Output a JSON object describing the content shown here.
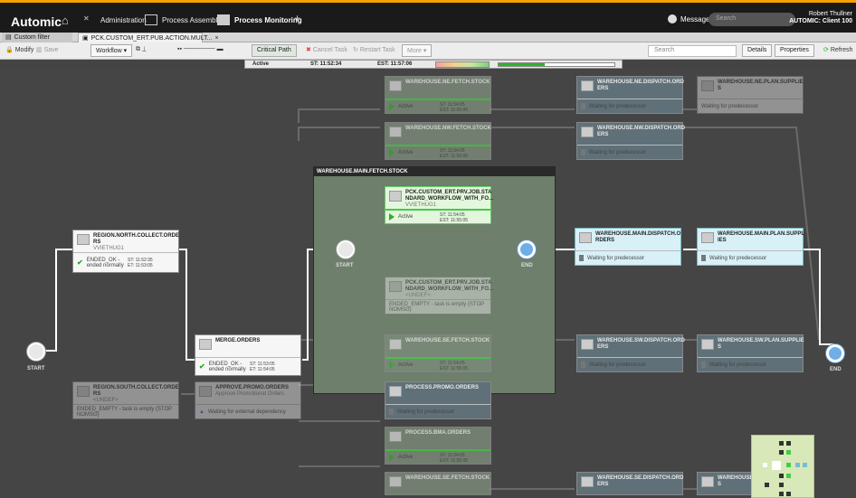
{
  "top": {
    "logo": "Automic",
    "nav": [
      "Administration",
      "Process Assembly",
      "Process Monitoring"
    ],
    "plus": "+",
    "messages": "Messages",
    "search_placeholder": "Search",
    "user_name": "Robert Thullner",
    "user_client": "AUTOMIC: Client 100",
    "accent": "#f5a000"
  },
  "tabs": {
    "filter": "Custom filter",
    "open": "PCK.CUSTOM_ERT.PUB.ACTION.MULT...",
    "close": "×"
  },
  "toolbar": {
    "modify": "Modify",
    "save": "Save",
    "workflow": "Workflow",
    "critical_path": "Critical Path",
    "cancel": "Cancel Task",
    "restart": "Restart Task",
    "more": "More",
    "search_placeholder": "Search",
    "details": "Details",
    "properties": "Properties",
    "refresh": "Refresh"
  },
  "status": {
    "state": "Active",
    "start": "ST: 11:52:34",
    "est": "EST: 11:57:06",
    "progress": 0.4
  },
  "group": {
    "title": "WAREHOUSE.MAIN.FETCH.STOCK"
  },
  "labels": {
    "start": "START",
    "end": "END"
  },
  "nodes": {
    "ne_fetch": {
      "title": "WAREHOUSE.NE.FETCH.STOCK",
      "status": "Active",
      "st": "ST: 11:54:05",
      "est": "EST: 11:55:05"
    },
    "ne_dispatch": {
      "title": "WAREHOUSE.NE.DISPATCH.ORD ERS",
      "status": "Waiting for predecessor"
    },
    "ne_plan": {
      "title": "WAREHOUSE.NE.PLAN.SUPPLIE S",
      "status": "Waiting for predecessor"
    },
    "nw_fetch": {
      "title": "WAREHOUSE.NW.FETCH.STOCK",
      "status": "Active",
      "st": "ST: 11:54:05",
      "est": "EST: 11:55:05"
    },
    "nw_dispatch": {
      "title": "WAREHOUSE.NW.DISPATCH.ORD ERS",
      "status": "Waiting for predecessor"
    },
    "north": {
      "title": "REGION.NORTH.COLLECT.ORDE RS",
      "sub": "VVIETHUG1",
      "status": "ENDED_OK - ended normally",
      "st": "ST: 11:52:35",
      "est": "ET: 11:53:05"
    },
    "inner_active": {
      "title": "PCK.CUSTOM_ERT.PRV.JOB.STA NDARD_WORKFLOW_WITH_FO...",
      "sub": "VVIETHUG1",
      "status": "Active",
      "st": "ST: 11:54:05",
      "est": "EST: 11:55:05"
    },
    "inner_empty": {
      "title": "PCK.CUSTOM_ERT.PRV.JOB.STA NDARD_WORKFLOW_WITH_FO...",
      "sub": "<UNDEF>",
      "status": "ENDED_EMPTY - task is empty (STOP NOMSG)"
    },
    "main_dispatch": {
      "title": "WAREHOUSE.MAIN.DISPATCH.O RDERS",
      "status": "Waiting for predecessor"
    },
    "main_plan": {
      "title": "WAREHOUSE.MAIN.PLAN.SUPPL IES",
      "status": "Waiting for predecessor"
    },
    "merge": {
      "title": "MERGE.ORDERS",
      "status": "ENDED_OK - ended normally",
      "st": "ST: 11:53:05",
      "est": "ET: 11:54:05"
    },
    "se_fetch": {
      "title": "WAREHOUSE.SE.FETCH.STOCK",
      "status": "Active",
      "st": "ST: 11:54:05",
      "est": "EST: 11:55:05"
    },
    "sw_dispatch": {
      "title": "WAREHOUSE.SW.DISPATCH.ORD ERS",
      "status": "Waiting for predecessor"
    },
    "sw_plan": {
      "title": "WAREHOUSE.SW.PLAN.SUPPLIE S",
      "status": "Waiting for predecessor"
    },
    "south": {
      "title": "REGION.SOUTH.COLLECT.ORDE RS",
      "sub": "<UNDEF>",
      "status": "ENDED_EMPTY - task is empty (STOP NOMSG)"
    },
    "approve": {
      "title": "APPROVE.PROMO.ORDERS",
      "sub": "Approve Promotional Orders",
      "status": "Waiting for external dependency"
    },
    "promo": {
      "title": "PROCESS.PROMO.ORDERS",
      "status": "Waiting for predecessor"
    },
    "bma": {
      "title": "PROCESS.BMA.ORDERS",
      "status": "Active",
      "st": "ST: 11:54:05",
      "est": "EST: 11:55:05"
    },
    "se2_fetch": {
      "title": "WAREHOUSE.SE.FETCH.STOCK"
    },
    "se2_dispatch": {
      "title": "WAREHOUSE.SE.DISPATCH.ORD ERS"
    },
    "se2_plan": {
      "title": "WAREHOUSE.SE.PLAN.SUPPLIE S"
    }
  }
}
